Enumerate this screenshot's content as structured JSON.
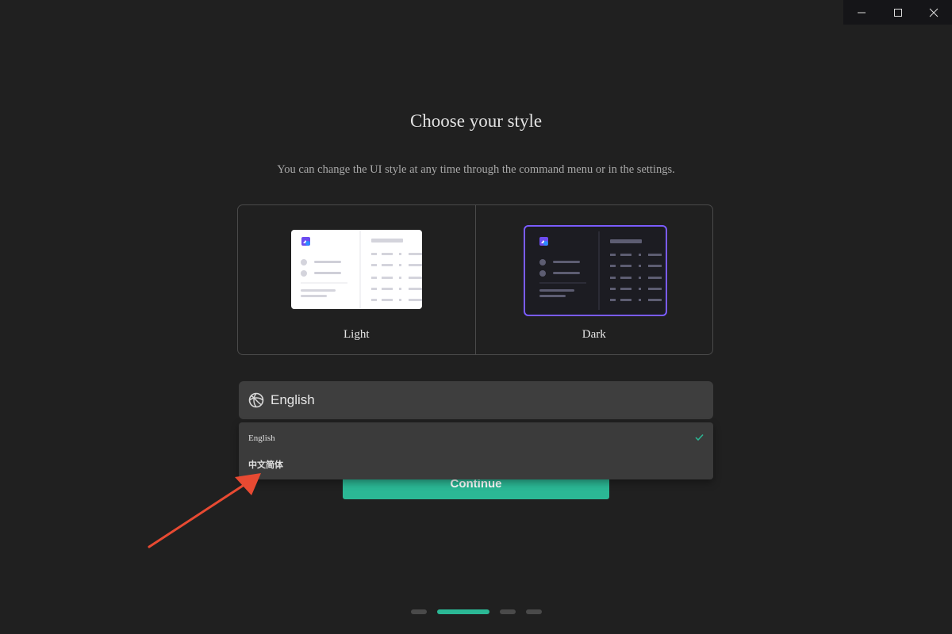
{
  "window": {
    "icons": [
      "minimize-icon",
      "maximize-icon",
      "close-icon"
    ]
  },
  "header": {
    "title": "Choose your style",
    "subtitle": "You can change the UI style at any time through the command menu or in the settings."
  },
  "styles": {
    "options": [
      {
        "label": "Light",
        "selected": false
      },
      {
        "label": "Dark",
        "selected": true
      }
    ]
  },
  "language": {
    "selected_value": "English",
    "icon": "globe-icon",
    "options": [
      {
        "label": "English",
        "checked": true
      },
      {
        "label": "中文简体",
        "checked": false
      }
    ]
  },
  "actions": {
    "continue_label": "Continue"
  },
  "steps": {
    "total": 4,
    "active_index": 1
  },
  "colors": {
    "accent": "#2bb895",
    "selection_border": "#7a5cff",
    "annotation_arrow": "#e84a32"
  }
}
